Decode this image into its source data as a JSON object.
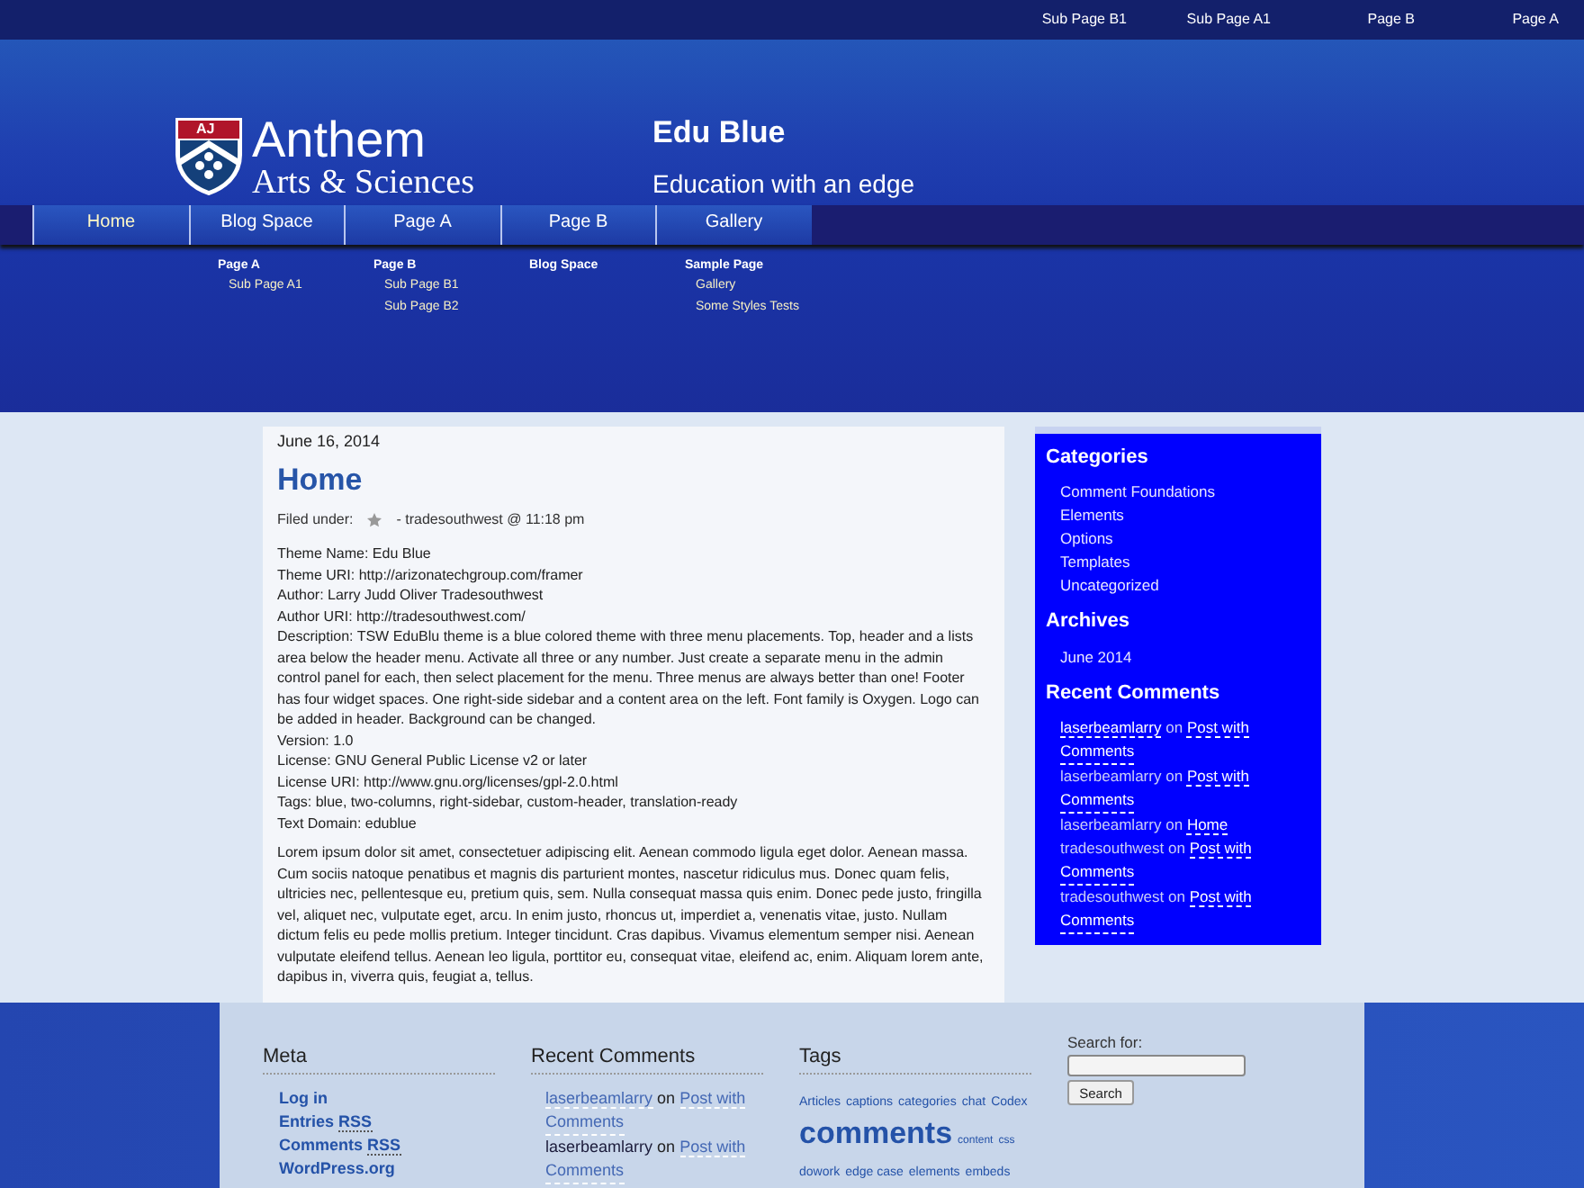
{
  "top_menu": [
    "Sub Page B1",
    "Sub Page A1",
    "Page B",
    "Page A"
  ],
  "logo": {
    "line1": "Anthem",
    "line2": "Arts & Sciences",
    "badge": "AJ"
  },
  "site": {
    "title": "Edu Blue",
    "tagline": "Education with an edge"
  },
  "nav": [
    {
      "label": "Home",
      "selected": true
    },
    {
      "label": "Blog Space",
      "selected": false
    },
    {
      "label": "Page A",
      "selected": false
    },
    {
      "label": "Page B",
      "selected": false
    },
    {
      "label": "Gallery",
      "selected": false
    }
  ],
  "lists_menu": [
    {
      "title": "Page A",
      "items": [
        "Sub Page A1"
      ]
    },
    {
      "title": "Page B",
      "items": [
        "Sub Page B1",
        "Sub Page B2"
      ]
    },
    {
      "title": "Blog Space"
    },
    {
      "title": "Sample Page",
      "items": [
        "Gallery",
        "Some Styles Tests"
      ]
    }
  ],
  "post": {
    "date": "June 16, 2014",
    "title": "Home",
    "filed_label": "Filed under:",
    "meta": "- tradesouthwest @ 11:18 pm",
    "lines": [
      "Theme Name: Edu Blue",
      "Theme URI: http://arizonatechgroup.com/framer",
      "Author: Larry Judd Oliver Tradesouthwest",
      "Author URI: http://tradesouthwest.com/",
      "Description: TSW EduBlu theme is a blue colored theme with three menu placements. Top, header and a lists area below the header menu. Activate all three or any number. Just create a separate menu in the admin control panel for each, then select placement for the menu. Three menus are always better than one! Footer has four widget spaces. One right-side sidebar and a content area on the left. Font family is Oxygen. Logo can be added in header. Background can be changed.",
      "Version: 1.0",
      "License: GNU General Public License v2 or later",
      "License URI: http://www.gnu.org/licenses/gpl-2.0.html",
      "Tags: blue, two-columns, right-sidebar, custom-header, translation-ready",
      "Text Domain: edublue"
    ],
    "paragraph": "Lorem ipsum dolor sit amet, consectetuer adipiscing elit. Aenean commodo ligula eget dolor. Aenean massa. Cum sociis natoque penatibus et magnis dis parturient montes, nascetur ridiculus mus. Donec quam felis, ultricies nec, pellentesque eu, pretium quis, sem. Nulla consequat massa quis enim. Donec pede justo, fringilla vel, aliquet nec, vulputate eget, arcu. In enim justo, rhoncus ut, imperdiet a, venenatis vitae, justo. Nullam dictum felis eu pede mollis pretium. Integer tincidunt. Cras dapibus. Vivamus elementum semper nisi. Aenean vulputate eleifend tellus. Aenean leo ligula, porttitor eu, consequat vitae, eleifend ac, enim. Aliquam lorem ante, dapibus in, viverra quis, feugiat a, tellus."
  },
  "sidebar": {
    "categories_title": "Categories",
    "categories": [
      "Comment Foundations",
      "Elements",
      "Options",
      "Templates",
      "Uncategorized"
    ],
    "archives_title": "Archives",
    "archives": [
      "June 2014"
    ],
    "comments_title": "Recent Comments",
    "comments": [
      {
        "author": "laserbeamlarry",
        "author_linked": true,
        "on": "on",
        "post": [
          "Post with",
          "Comments"
        ]
      },
      {
        "author": "laserbeamlarry",
        "author_linked": false,
        "on": "on",
        "post": [
          "Post with",
          "Comments"
        ]
      },
      {
        "author": "laserbeamlarry",
        "author_linked": false,
        "on": "on",
        "post": [
          "Home"
        ]
      },
      {
        "author": "tradesouthwest",
        "author_linked": false,
        "on": "on",
        "post": [
          "Post with",
          "Comments"
        ]
      },
      {
        "author": "tradesouthwest",
        "author_linked": false,
        "on": "on",
        "post": [
          "Post with",
          "Comments"
        ]
      }
    ]
  },
  "footer": {
    "meta_title": "Meta",
    "meta_links": [
      {
        "text": "Log in"
      },
      {
        "text": "Entries",
        "abbr": "RSS"
      },
      {
        "text": "Comments",
        "abbr": "RSS"
      },
      {
        "text": "WordPress.org"
      }
    ],
    "comments_title": "Recent Comments",
    "comments": [
      {
        "author": "laserbeamlarry",
        "author_linked": true,
        "on": "on",
        "post": [
          "Post with",
          "Comments"
        ]
      },
      {
        "author": "laserbeamlarry",
        "author_linked": false,
        "on": "on",
        "post": [
          "Post with",
          "Comments"
        ]
      }
    ],
    "tags_title": "Tags",
    "tags": [
      {
        "label": "Articles",
        "kind": "small"
      },
      {
        "label": "captions",
        "kind": "small"
      },
      {
        "label": "categories",
        "kind": "small"
      },
      {
        "label": "chat",
        "kind": "small"
      },
      {
        "label": "Codex",
        "kind": "small"
      },
      {
        "label": "comments",
        "kind": "large"
      },
      {
        "label": "content",
        "kind": "tiny"
      },
      {
        "label": "css",
        "kind": "tiny"
      },
      {
        "label": "dowork",
        "kind": "small"
      },
      {
        "label": "edge case",
        "kind": "small"
      },
      {
        "label": "elements",
        "kind": "small"
      },
      {
        "label": "embeds",
        "kind": "small"
      }
    ],
    "search_label": "Search for:",
    "search_button": "Search"
  }
}
